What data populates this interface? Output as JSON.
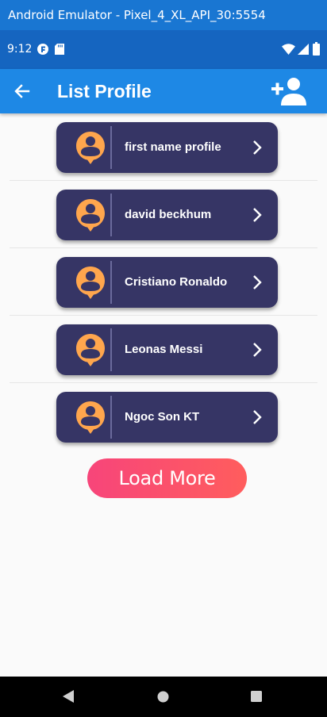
{
  "emulator": {
    "title": "Android Emulator - Pixel_4_XL_API_30:5554"
  },
  "status_bar": {
    "time": "9:12",
    "icons": [
      "flutter-debug-icon",
      "sd-card-icon",
      "wifi-icon",
      "signal-icon",
      "battery-icon"
    ]
  },
  "app_bar": {
    "title": "List Profile",
    "back_icon": "arrow-back-icon",
    "action_icon": "person-add-icon",
    "color": "#1e88e5"
  },
  "profiles": [
    {
      "name": "first name profile"
    },
    {
      "name": "david beckhum"
    },
    {
      "name": "Cristiano Ronaldo"
    },
    {
      "name": "Leonas Messi"
    },
    {
      "name": "Ngoc Son KT"
    }
  ],
  "card_style": {
    "background": "#363565",
    "avatar_color": "#ffa64d",
    "avatar_icon": "person-pin-icon",
    "chevron_icon": "chevron-right-icon"
  },
  "load_more": {
    "label": "Load More",
    "gradient": [
      "#f7457a",
      "#ff5d5d"
    ]
  },
  "nav_bar": {
    "items": [
      "back-nav-icon",
      "home-nav-icon",
      "recents-nav-icon"
    ]
  }
}
